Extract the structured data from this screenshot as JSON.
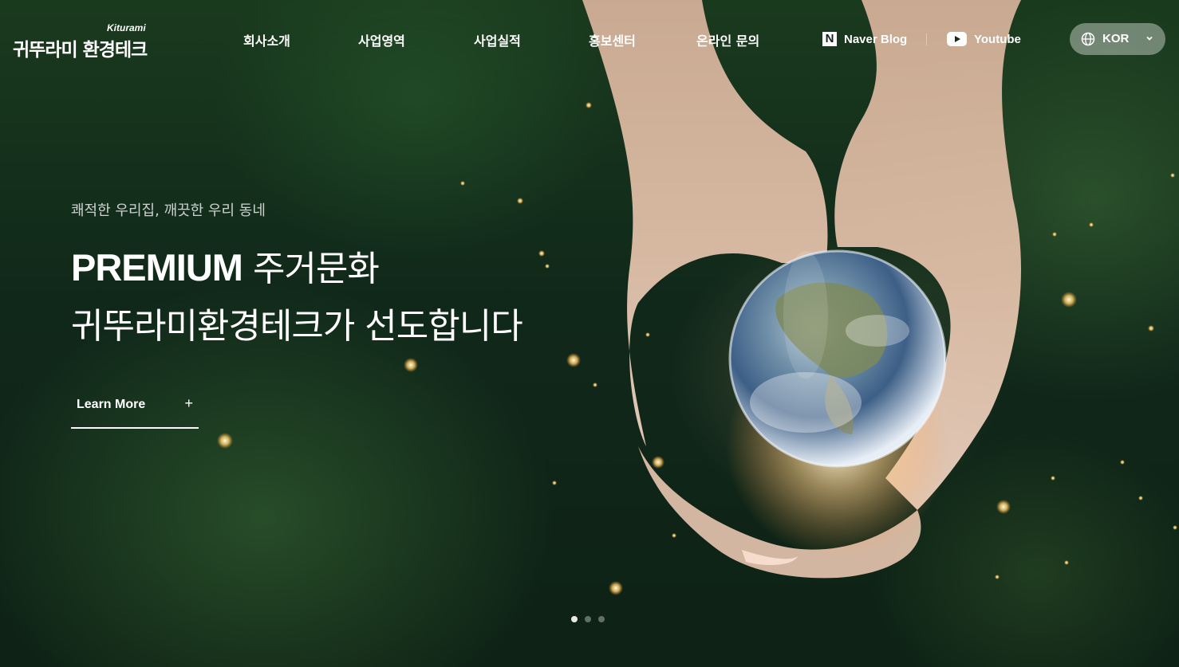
{
  "header": {
    "logo_korean": "귀뚜라미 환경테크",
    "logo_english": "Kiturami",
    "nav": [
      "회사소개",
      "사업영역",
      "사업실적",
      "홍보센터",
      "온라인 문의"
    ],
    "links": {
      "naver_blog": "Naver Blog",
      "youtube": "Youtube"
    },
    "language": "KOR"
  },
  "hero": {
    "tagline": "쾌적한 우리집, 깨끗한 우리 동네",
    "headline_emphasis": "PREMIUM",
    "headline_line1_rest": " 주거문화",
    "headline_line2": "귀뚜라미환경테크가 선도합니다",
    "cta_label": "Learn More",
    "cta_icon": "+"
  },
  "slider": {
    "count": 3,
    "active_index": 1
  },
  "colors": {
    "background": "#12301a",
    "text": "#ffffff"
  },
  "icons": [
    "naver-icon",
    "youtube-icon",
    "globe-icon",
    "chevron-down-icon",
    "plus-icon"
  ]
}
